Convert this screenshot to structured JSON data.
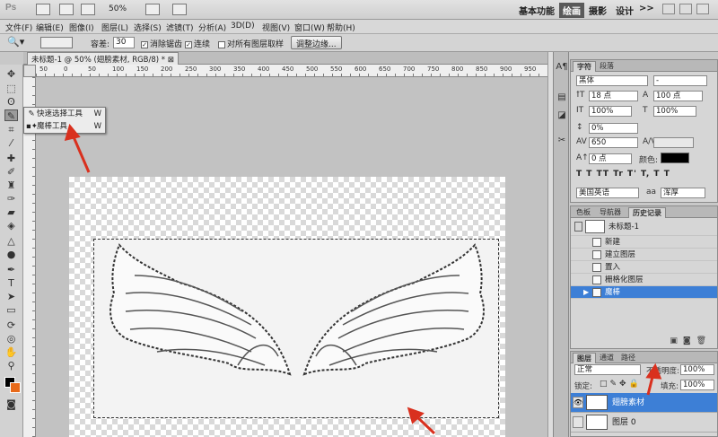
{
  "app": {
    "logo": "Ps",
    "zoom_menu": "50%",
    "workspaces": [
      "基本功能",
      "绘画",
      "摄影",
      "设计"
    ],
    "active_workspace": "绘画",
    "more": ">>"
  },
  "menu": [
    "文件(F)",
    "编辑(E)",
    "图像(I)",
    "图层(L)",
    "选择(S)",
    "滤镜(T)",
    "分析(A)",
    "3D(D)",
    "视图(V)",
    "窗口(W)",
    "帮助(H)"
  ],
  "options": {
    "tolerance_label": "容差:",
    "tolerance_value": "30",
    "antialias": "消除锯齿",
    "contiguous": "连续",
    "sample_all": "对所有图层取样",
    "refine_edge": "调整边缘..."
  },
  "document": {
    "tab_title": "未标题-1 @ 50% (翅膀素材, RGB/8) *",
    "ruler_ticks": [
      "50",
      "0",
      "50",
      "100",
      "150",
      "200",
      "250",
      "300",
      "350",
      "400",
      "450",
      "500",
      "550",
      "600",
      "650",
      "700",
      "750",
      "800",
      "850",
      "900",
      "950"
    ]
  },
  "flyout": {
    "items": [
      {
        "label": "快速选择工具",
        "key": "W",
        "active": false
      },
      {
        "label": "魔棒工具",
        "key": "W",
        "active": true
      }
    ]
  },
  "character": {
    "tabs": [
      "字符",
      "段落"
    ],
    "font_family": "黑体",
    "font_style": "-",
    "size": "18 点",
    "leading": "100 点",
    "vscale": "100%",
    "hscale": "100%",
    "baseline": "0%",
    "tracking": "650",
    "shift": "0 点",
    "color_label": "颜色:",
    "color": "#000000",
    "styles": [
      "T",
      "T",
      "TT",
      "Tr",
      "T'",
      "T,",
      "T",
      "T"
    ],
    "language": "美国英语",
    "antialias_label": "aa",
    "antialias": "浑厚"
  },
  "history": {
    "tabs": [
      "色板",
      "导航器",
      "历史记录"
    ],
    "snapshot": "未标题-1",
    "items": [
      "新建",
      "建立图层",
      "置入",
      "栅格化图层",
      "魔棒"
    ],
    "selected": "魔棒"
  },
  "layers": {
    "tabs": [
      "图层",
      "通道",
      "路径"
    ],
    "blend_mode": "正常",
    "opacity_label": "不透明度:",
    "opacity": "100%",
    "lock_label": "锁定:",
    "fill_label": "填充:",
    "fill": "100%",
    "items": [
      {
        "name": "翅膀素材",
        "selected": true
      },
      {
        "name": "图层 0",
        "selected": false
      }
    ]
  },
  "colors": {
    "selection_blue": "#3d7fd6",
    "arrow_red": "#d9301e",
    "bg_swatch": "#e86a1a"
  }
}
